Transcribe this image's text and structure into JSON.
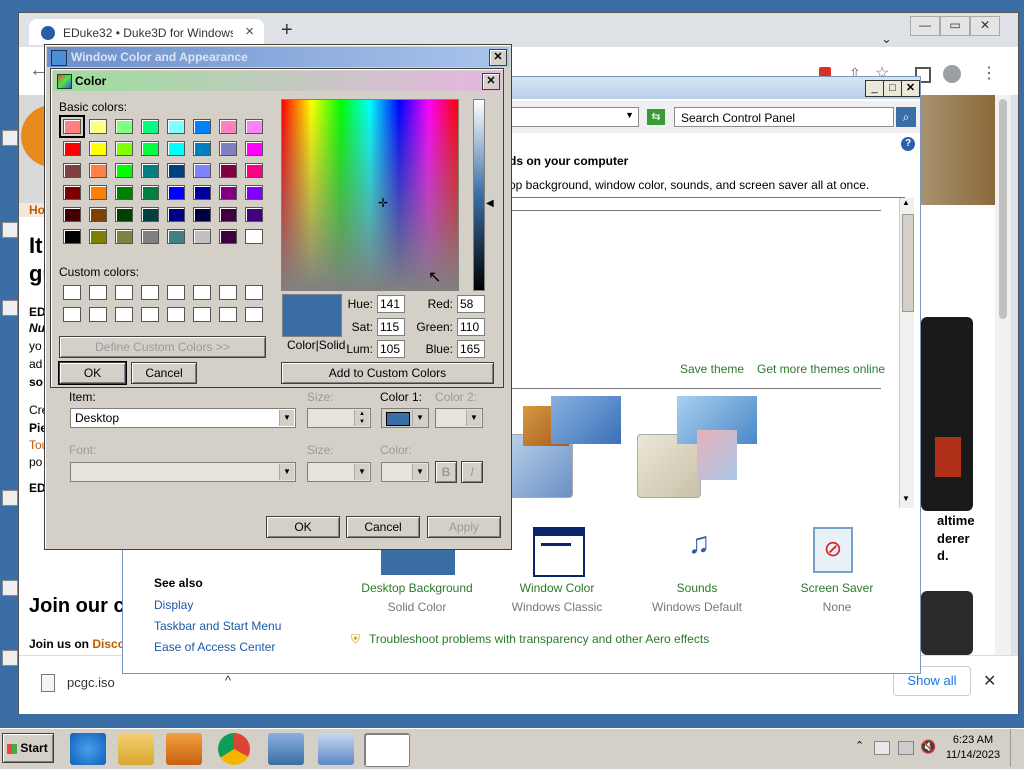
{
  "chrome": {
    "tab_title": "EDuke32 • Duke3D for Windows",
    "tab_close": "×",
    "new_tab": "+",
    "tab_dropdown": "⌄",
    "min": "—",
    "max": "▭",
    "close": "✕",
    "download": {
      "file": "pcgc.iso",
      "show_all": "Show all",
      "close": "✕",
      "expand": "^"
    }
  },
  "webpage": {
    "nav": "Ho",
    "heading_1": "It",
    "heading_2": "gu",
    "p1a": "ED",
    "p1b": "Nu",
    "p1c": "yo",
    "p1d": "ad",
    "p1e": "so",
    "p2a": "Cre",
    "p2b": "Pie",
    "p2c": "Tou",
    "p2d": "po",
    "p3": "ED",
    "join_title": "Join our c",
    "join_text": "Join us on ",
    "join_link": "Disco",
    "right_1": "altime",
    "right_2": "derer",
    "right_3": "d."
  },
  "control_panel": {
    "search_placeholder": "Search Control Panel",
    "heading": "ds on your computer",
    "subtext": "op background, window color, sounds, and screen saver all at once.",
    "save_theme": "Save theme",
    "more_themes": "Get more themes online",
    "see_also_title": "See also",
    "see_also": [
      "Display",
      "Taskbar and Start Menu",
      "Ease of Access Center"
    ],
    "categories": [
      {
        "label": "Desktop Background",
        "sub": "Solid Color"
      },
      {
        "label": "Window Color",
        "sub": "Windows Classic"
      },
      {
        "label": "Sounds",
        "sub": "Windows Default"
      },
      {
        "label": "Screen Saver",
        "sub": "None"
      }
    ],
    "troubleshoot": "Troubleshoot problems with transparency and other Aero effects",
    "help": "?"
  },
  "wca": {
    "title": "Window Color and Appearance",
    "close": "✕",
    "item_label": "Item:",
    "item_value": "Desktop",
    "size_label": "Size:",
    "color1_label": "Color 1:",
    "color2_label": "Color 2:",
    "font_label": "Font:",
    "font_size_label": "Size:",
    "font_color_label": "Color:",
    "bold": "B",
    "italic": "I",
    "ok": "OK",
    "cancel": "Cancel",
    "apply": "Apply"
  },
  "color_dialog": {
    "title": "Color",
    "close": "✕",
    "basic_colors_label": "Basic colors:",
    "custom_colors_label": "Custom colors:",
    "define_custom": "Define Custom Colors >>",
    "ok": "OK",
    "cancel": "Cancel",
    "add_custom": "Add to Custom Colors",
    "color_solid": "Color|Solid",
    "hue_label": "Hue:",
    "hue": "141",
    "sat_label": "Sat:",
    "sat": "115",
    "lum_label": "Lum:",
    "lum": "105",
    "red_label": "Red:",
    "red": "58",
    "green_label": "Green:",
    "green": "110",
    "blue_label": "Blue:",
    "blue": "165",
    "current_color": "#3a6ea5",
    "basic_colors": [
      "#ff8080",
      "#ffff80",
      "#80ff80",
      "#00ff80",
      "#80ffff",
      "#0080ff",
      "#ff80c0",
      "#ff80ff",
      "#ff0000",
      "#ffff00",
      "#80ff00",
      "#00ff40",
      "#00ffff",
      "#0080c0",
      "#8080c0",
      "#ff00ff",
      "#804040",
      "#ff8040",
      "#00ff00",
      "#008080",
      "#004080",
      "#8080ff",
      "#800040",
      "#ff0080",
      "#800000",
      "#ff8000",
      "#008000",
      "#008040",
      "#0000ff",
      "#0000a0",
      "#800080",
      "#8000ff",
      "#400000",
      "#804000",
      "#004000",
      "#004040",
      "#000080",
      "#000040",
      "#400040",
      "#400080",
      "#000000",
      "#808000",
      "#808040",
      "#808080",
      "#408080",
      "#c0c0c0",
      "#400040",
      "#ffffff"
    ]
  },
  "taskbar": {
    "start": "Start",
    "time": "6:23 AM",
    "date": "11/14/2023"
  }
}
